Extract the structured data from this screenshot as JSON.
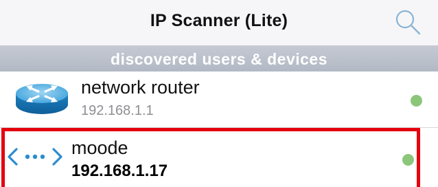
{
  "header": {
    "title": "IP Scanner (Lite)",
    "search_icon": "search-icon"
  },
  "section": {
    "title": "discovered users & devices"
  },
  "devices": [
    {
      "name": "network router",
      "ip": "192.168.1.1",
      "icon": "router-icon",
      "status_color": "#8cc67a",
      "online": true
    },
    {
      "name": "moode",
      "ip": "192.168.1.17",
      "icon": "network-device-icon",
      "status_color": "#8cc67a",
      "online": true
    }
  ],
  "highlight_color": "#e4000f"
}
